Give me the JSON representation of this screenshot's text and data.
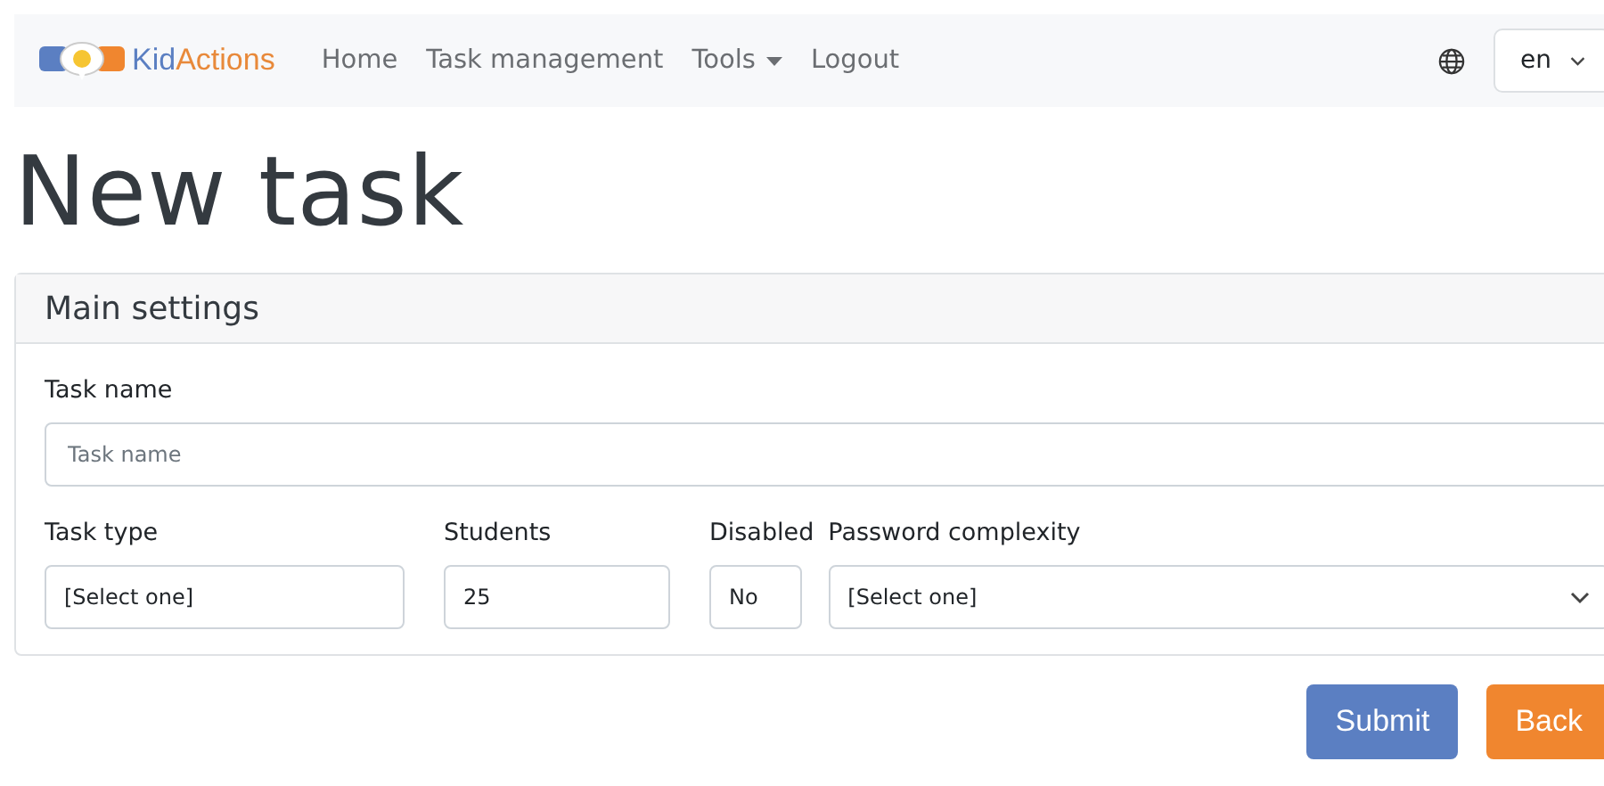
{
  "navbar": {
    "logo": {
      "first": "Kid",
      "second": "Actions"
    },
    "links": [
      {
        "label": "Home",
        "dropdown": false
      },
      {
        "label": "Task management",
        "dropdown": false
      },
      {
        "label": "Tools",
        "dropdown": true
      },
      {
        "label": "Logout",
        "dropdown": false
      }
    ],
    "language": {
      "value": "en"
    }
  },
  "heading": "New task",
  "card": {
    "title": "Main settings",
    "task_name": {
      "label": "Task name",
      "placeholder": "Task name"
    },
    "fields": [
      {
        "label": "Task type",
        "value": "[Select one]",
        "kind": "input"
      },
      {
        "label": "Students",
        "value": "25",
        "kind": "input"
      },
      {
        "label": "Disabled",
        "value": "No",
        "kind": "input"
      },
      {
        "label": "Password complexity",
        "value": "[Select one]",
        "kind": "select"
      }
    ]
  },
  "buttons": [
    {
      "label": "Submit",
      "kind": "primary"
    },
    {
      "label": "Back",
      "kind": "secondary"
    }
  ]
}
